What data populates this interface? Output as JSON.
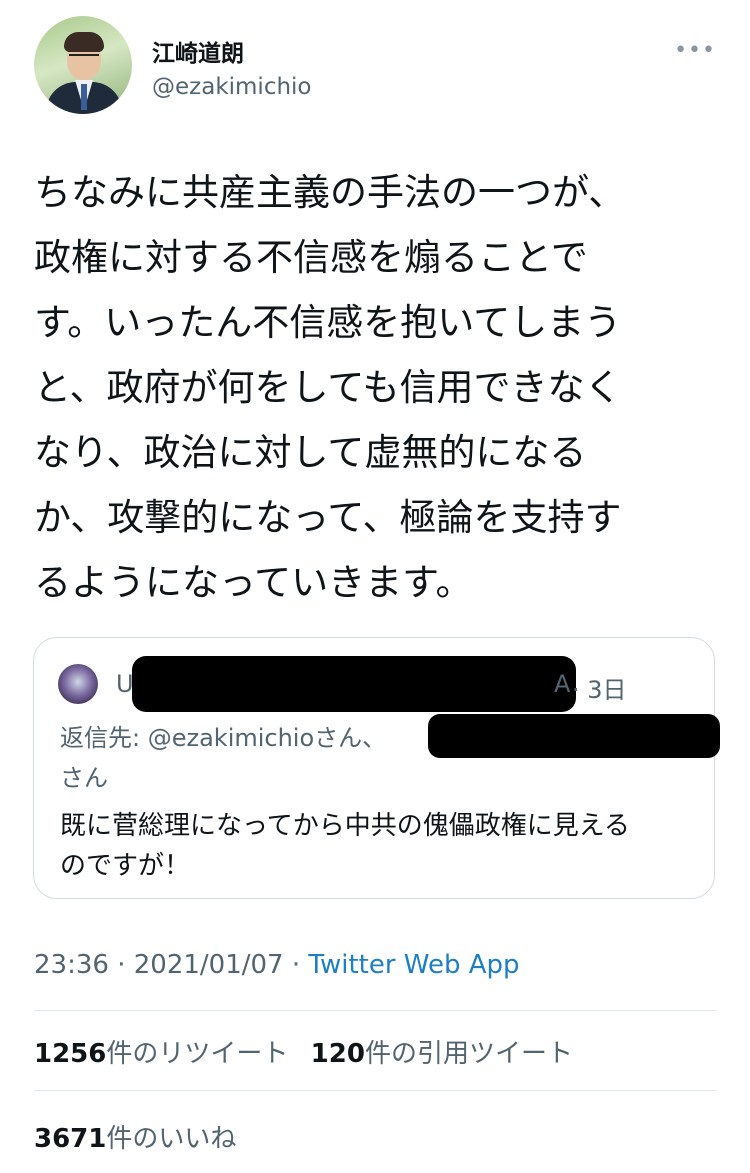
{
  "author": {
    "display_name": "江崎道朗",
    "handle": "@ezakimichio"
  },
  "more_menu_label": "•••",
  "tweet": {
    "text": "ちなみに共産主義の手法の一つが、\n政権に対する不信感を煽ることで\nす。いったん不信感を抱いてしまう\nと、政府が何をしても信用できなく\nなり、政治に対して虚無的になる\nか、攻撃的になって、極論を支持す\nるようになっていきます。"
  },
  "quoted_tweet": {
    "name_visible_start": "U",
    "name_visible_end": "A",
    "time": "· 3日",
    "reply_prefix": "返信先: ",
    "reply_handle": "@ezakimichio",
    "reply_suffix": "さん、",
    "reply_line2": "さん",
    "text": "既に菅総理になってから中共の傀儡政権に見える\nのですが！"
  },
  "meta": {
    "time": "23:36",
    "separator": " · ",
    "date": "2021/01/07",
    "source": "Twitter Web App"
  },
  "stats": {
    "retweets_count": "1256",
    "retweets_label": "件のリツイート",
    "quotes_count": "120",
    "quotes_label": "件の引用ツイート",
    "likes_count": "3671",
    "likes_label": "件のいいね"
  },
  "colors": {
    "text": "#0f1419",
    "secondary": "#536471",
    "link": "#1d7fc4",
    "border": "#d3dbe2"
  }
}
